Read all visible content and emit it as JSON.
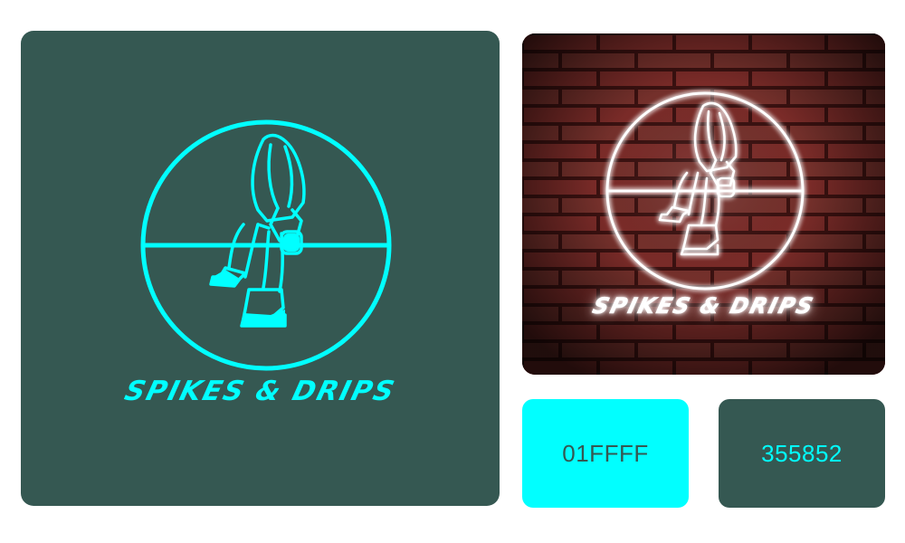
{
  "logo": {
    "brand_name": "SPIKES & DRIPS"
  },
  "palette": {
    "colors": [
      {
        "hex": "01FFFF",
        "fill": "#01ffff",
        "text_color": "#355852"
      },
      {
        "hex": "355852",
        "fill": "#355852",
        "text_color": "#01ffff"
      }
    ]
  },
  "colors": {
    "accent_cyan": "#01ffff",
    "dark_green": "#355852",
    "brick": "#7a2b28",
    "neon_white": "#ffffff"
  }
}
